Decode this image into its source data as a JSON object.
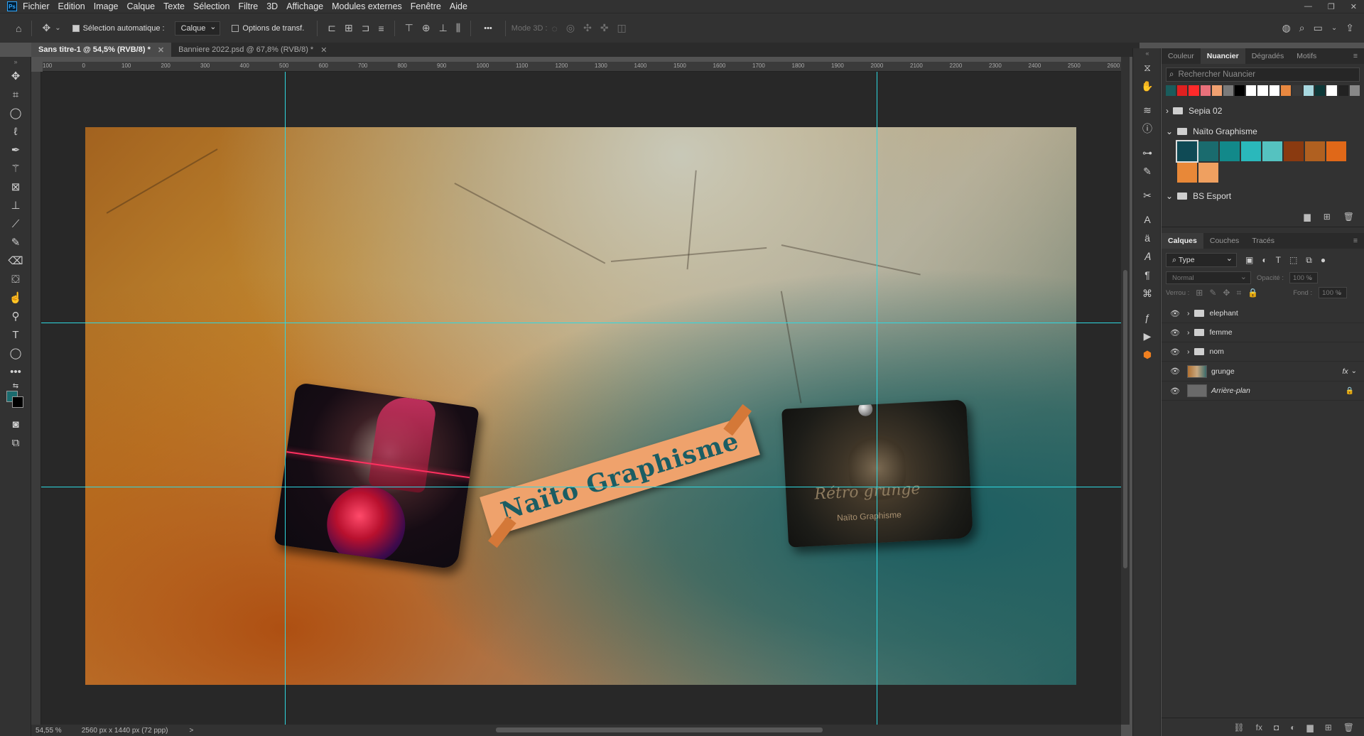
{
  "app": {
    "logo": "Ps"
  },
  "menu": [
    "Fichier",
    "Edition",
    "Image",
    "Calque",
    "Texte",
    "Sélection",
    "Filtre",
    "3D",
    "Affichage",
    "Modules externes",
    "Fenêtre",
    "Aide"
  ],
  "options": {
    "auto_select_label": "Sélection automatique :",
    "auto_select_value": "Calque",
    "transform_label": "Options de transf.",
    "mode3d_label": "Mode 3D :",
    "more": "•••"
  },
  "tabs": [
    {
      "label": "Sans titre-1 @ 54,5% (RVB/8) *",
      "active": true
    },
    {
      "label": "Banniere 2022.psd @ 67,8% (RVB/8) *",
      "active": false
    }
  ],
  "ruler_h": [
    "100",
    "0",
    "100",
    "200",
    "300",
    "400",
    "500",
    "600",
    "700",
    "800",
    "900",
    "1000",
    "1100",
    "1200",
    "1300",
    "1400",
    "1500",
    "1600",
    "1700",
    "1800",
    "1900",
    "2000",
    "2100",
    "2200",
    "2300",
    "2400",
    "2500",
    "2600"
  ],
  "canvas": {
    "banner_text": "Naïto Graphisme",
    "photo2_title": "Rétro grunge",
    "photo2_sub": "Naïto Graphisme"
  },
  "status": {
    "zoom": "54,55 %",
    "doc_size": "2560 px x 1440 px (72 ppp)",
    "arrow": ">"
  },
  "swatch_panel": {
    "tabs": [
      "Couleur",
      "Nuancier",
      "Dégradés",
      "Motifs"
    ],
    "active_tab": "Nuancier",
    "search_placeholder": "Rechercher Nuancier",
    "recent_colors": [
      "#1a5c5c",
      "#e02020",
      "#ff2a2a",
      "#e8707a",
      "#f0a070",
      "#7a7a7a",
      "#000000",
      "#ffffff",
      "#ffffff",
      "#ffffff",
      "#e88840",
      "#3a3a3a",
      "#a8d8e0",
      "#0d3838",
      "#ffffff",
      "#222222",
      "#888888"
    ],
    "groups": [
      {
        "name": "Sepia 02",
        "expanded": false
      },
      {
        "name": "Naïto Graphisme",
        "expanded": true,
        "colors": [
          "#0f4a55",
          "#1a6b6e",
          "#12898a",
          "#2ab8bb",
          "#55c2c0",
          "#8a3a10",
          "#b06020",
          "#e06818",
          "#e88838",
          "#efa060"
        ]
      },
      {
        "name": "BS Esport",
        "expanded": false
      }
    ]
  },
  "layers_panel": {
    "tabs": [
      "Calques",
      "Couches",
      "Tracés"
    ],
    "active_tab": "Calques",
    "filter": "Type",
    "blend": "Normal",
    "opacity_label": "Opacité :",
    "opacity_value": "100 %",
    "lock_label": "Verrou :",
    "fill_label": "Fond :",
    "fill_value": "100 %",
    "layers": [
      {
        "name": "elephant",
        "type": "group"
      },
      {
        "name": "femme",
        "type": "group"
      },
      {
        "name": "nom",
        "type": "group"
      },
      {
        "name": "grunge",
        "type": "layer",
        "fx": "fx"
      },
      {
        "name": "Arrière-plan",
        "type": "background"
      }
    ]
  }
}
